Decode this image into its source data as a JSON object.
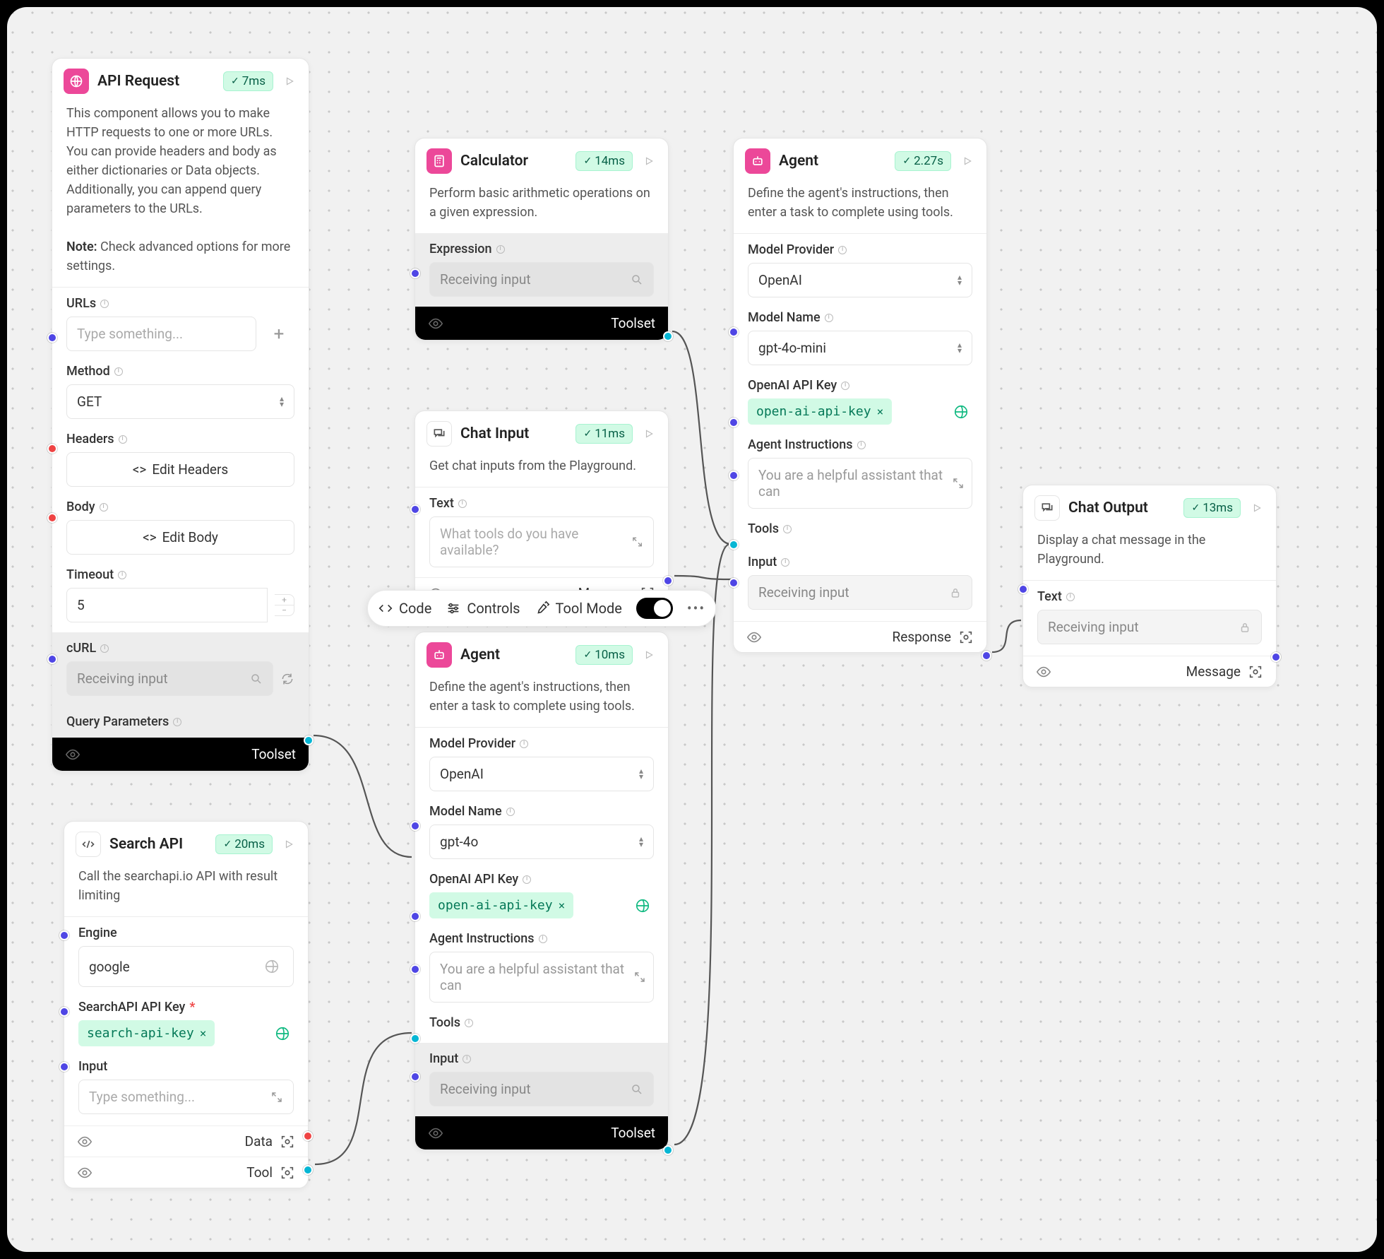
{
  "toolbar": {
    "code": "Code",
    "controls": "Controls",
    "toolmode": "Tool Mode"
  },
  "common": {
    "type_something": "Type something...",
    "receiving_input": "Receiving input",
    "expression": "Expression",
    "model_provider": "Model Provider",
    "model_name": "Model Name",
    "openai_api_key": "OpenAI API Key",
    "agent_instructions": "Agent Instructions",
    "tools": "Tools",
    "input": "Input",
    "text": "Text",
    "instr_placeholder": "You are a helpful assistant that can"
  },
  "api": {
    "title": "API Request",
    "badge": "7ms",
    "desc": "This component allows you to make HTTP requests to one or more URLs. You can provide headers and body as either dictionaries or Data objects. Additionally, you can append query parameters to the URLs.",
    "note_label": "Note:",
    "note": " Check advanced options for more settings.",
    "urls_label": "URLs",
    "method_label": "Method",
    "method_val": "GET",
    "headers_label": "Headers",
    "edit_headers": "Edit Headers",
    "body_label": "Body",
    "edit_body": "Edit Body",
    "timeout_label": "Timeout",
    "timeout_val": "5",
    "curl_label": "cURL",
    "qparams": "Query Parameters",
    "toolset": "Toolset"
  },
  "search": {
    "title": "Search API",
    "badge": "20ms",
    "desc": "Call the searchapi.io API with result limiting",
    "engine_label": "Engine",
    "engine_val": "google",
    "apikey_label": "SearchAPI API Key",
    "apikey_chip": "search-api-key",
    "input_label": "Input",
    "data": "Data",
    "tool": "Tool"
  },
  "calc": {
    "title": "Calculator",
    "badge": "14ms",
    "desc": "Perform basic arithmetic operations on a given expression.",
    "toolset": "Toolset"
  },
  "chatin": {
    "title": "Chat Input",
    "badge": "11ms",
    "desc": "Get chat inputs from the Playground.",
    "text_val": "What tools do you have available?",
    "message": "Message"
  },
  "agent1": {
    "title": "Agent",
    "badge": "2.27s",
    "desc": "Define the agent's instructions, then enter a task to complete using tools.",
    "provider": "OpenAI",
    "model": "gpt-4o-mini",
    "key_chip": "open-ai-api-key",
    "response": "Response"
  },
  "agent2": {
    "title": "Agent",
    "badge": "10ms",
    "desc": "Define the agent's instructions, then enter a task to complete using tools.",
    "provider": "OpenAI",
    "model": "gpt-4o",
    "key_chip": "open-ai-api-key",
    "toolset": "Toolset"
  },
  "chatout": {
    "title": "Chat Output",
    "badge": "13ms",
    "desc": "Display a chat message in the Playground.",
    "message": "Message"
  }
}
